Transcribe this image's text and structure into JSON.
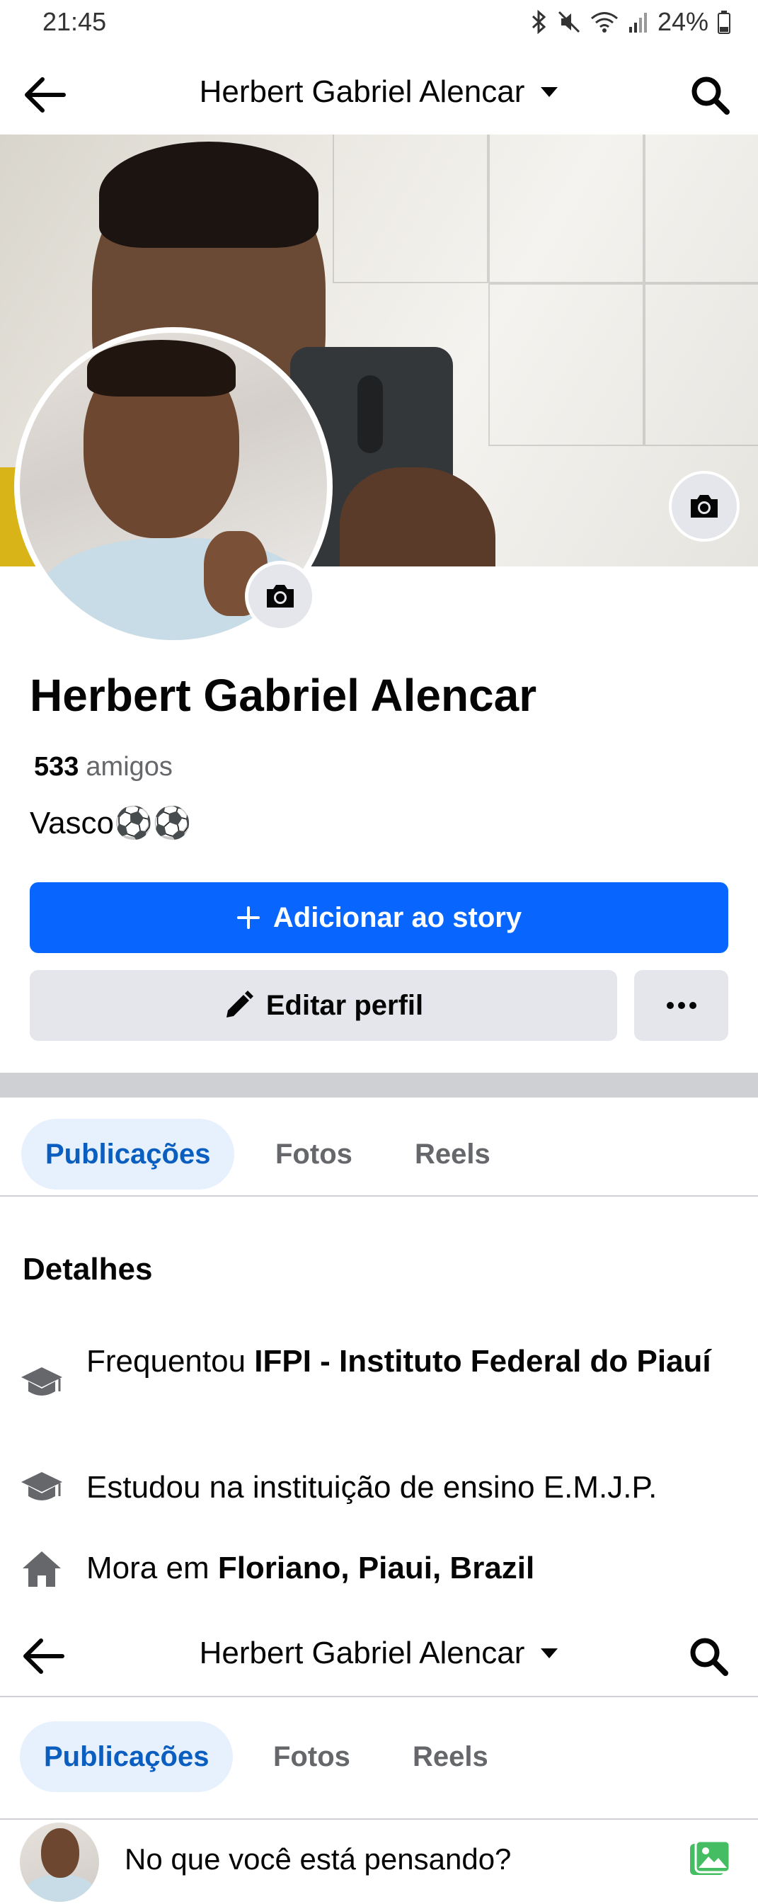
{
  "status_bar": {
    "time": "21:45",
    "battery": "24%",
    "icons": [
      "bluetooth-icon",
      "mute-icon",
      "wifi-icon",
      "signal-icon",
      "battery-icon"
    ]
  },
  "header": {
    "title": "Herbert Gabriel Alencar",
    "icons": [
      "back-arrow-icon",
      "caret-down-icon",
      "search-icon"
    ]
  },
  "profile": {
    "name": "Herbert Gabriel Alencar",
    "friends_count": "533",
    "friends_label": "amigos",
    "bio": "Vasco⚽⚽"
  },
  "actions": {
    "add_story": "Adicionar ao story",
    "edit_profile": "Editar perfil"
  },
  "tabs": [
    "Publicações",
    "Fotos",
    "Reels"
  ],
  "details": {
    "title": "Detalhes",
    "items": [
      {
        "icon": "graduation-cap-icon",
        "prefix": "Frequentou ",
        "bold": "IFPI - Instituto Federal do Piauí"
      },
      {
        "icon": "graduation-cap-icon",
        "prefix": "Estudou na instituição de ensino E.M.J.P.",
        "bold": ""
      },
      {
        "icon": "home-icon",
        "prefix": "Mora em ",
        "bold": "Floriano, Piaui, Brazil"
      }
    ]
  },
  "sticky_header": {
    "title": "Herbert Gabriel Alencar"
  },
  "sticky_tabs": [
    "Publicações",
    "Fotos",
    "Reels"
  ],
  "composer": {
    "placeholder": "No que você está pensando?"
  },
  "colors": {
    "primary": "#0866ff",
    "tab_active_bg": "#e7f1fd",
    "tab_active_text": "#0a5ebf",
    "secondary_button": "#e4e6eb",
    "photo_icon": "#45bd62"
  }
}
